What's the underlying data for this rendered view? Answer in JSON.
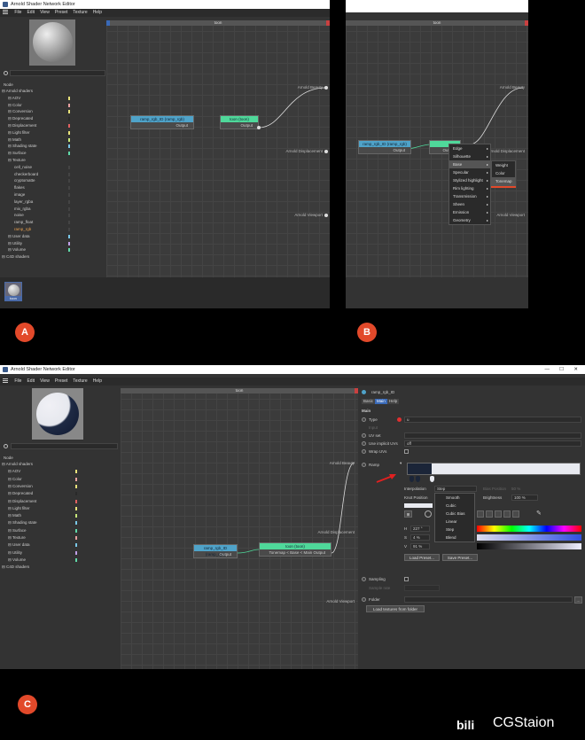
{
  "panel_a": {
    "title": "Arnold Shader Network Editor",
    "menu": [
      "File",
      "Edit",
      "View",
      "Preset",
      "Texture",
      "Help"
    ],
    "tree_header": "Node",
    "tree": [
      {
        "label": "Arnold shaders",
        "color": ""
      },
      {
        "label": "AOV",
        "color": "#e8e27a"
      },
      {
        "label": "Color",
        "color": "#e8a0a0"
      },
      {
        "label": "Conversion",
        "color": "#e8e27a"
      },
      {
        "label": "Deprecated",
        "color": "#2a2a2a"
      },
      {
        "label": "Displacement",
        "color": "#e06060"
      },
      {
        "label": "Light filter",
        "color": "#e8e27a"
      },
      {
        "label": "Math",
        "color": "#c8e87a"
      },
      {
        "label": "Shading state",
        "color": "#7ac8e8"
      },
      {
        "label": "Surface",
        "color": "#60d8a8"
      },
      {
        "label": "Texture",
        "color": ""
      },
      {
        "label": "cell_noise",
        "color": "#444"
      },
      {
        "label": "checkerboard",
        "color": "#444"
      },
      {
        "label": "cryptomatte",
        "color": "#444"
      },
      {
        "label": "flakes",
        "color": "#444"
      },
      {
        "label": "image",
        "color": "#444"
      },
      {
        "label": "layer_rgba",
        "color": "#444"
      },
      {
        "label": "mix_rgba",
        "color": "#444"
      },
      {
        "label": "noise",
        "color": "#444"
      },
      {
        "label": "ramp_float",
        "color": "#444"
      },
      {
        "label": "ramp_rgb",
        "color": "#444"
      },
      {
        "label": "User data",
        "color": "#7ac8e8"
      },
      {
        "label": "Utility",
        "color": "#c0a0e8"
      },
      {
        "label": "Volume",
        "color": "#60d8a8"
      },
      {
        "label": "C4D shaders",
        "color": ""
      }
    ],
    "canvas_tab": "toon",
    "node_ramp": {
      "title": "ramp_rgb_ID (ramp_rgb)",
      "output": "Output"
    },
    "node_toon": {
      "title": "toon (toon)",
      "output": "Output"
    },
    "outputs": [
      "Arnold Beauty",
      "Arnold Displacement",
      "Arnold Viewport"
    ],
    "thumb_label": "toon",
    "badge": "A"
  },
  "panel_b": {
    "canvas_tab": "toon",
    "node_ramp": {
      "title": "ramp_rgb_ID (ramp_rgb)",
      "output": "Output"
    },
    "node_toon_out": "Output",
    "outputs": [
      "Arnold Beauty",
      "Arnold Displacement",
      "Arnold Viewport"
    ],
    "menu1": [
      "Edge",
      "Silhouette",
      "Base",
      "Specular",
      "Stylized highlight",
      "Rim lighting",
      "Transmission",
      "Sheen",
      "Emission",
      "Geometry"
    ],
    "menu2": [
      "Weight",
      "Color",
      "Tonemap"
    ],
    "badge": "B"
  },
  "panel_c": {
    "title": "Arnold Shader Network Editor",
    "menu": [
      "File",
      "Edit",
      "View",
      "Preset",
      "Texture",
      "Help"
    ],
    "tree_header": "Node",
    "tree": [
      {
        "label": "Arnold shaders",
        "color": ""
      },
      {
        "label": "AOV",
        "color": "#e8e27a"
      },
      {
        "label": "Color",
        "color": "#e8a0a0"
      },
      {
        "label": "Conversion",
        "color": "#e8e27a"
      },
      {
        "label": "Deprecated",
        "color": "#2a2a2a"
      },
      {
        "label": "Displacement",
        "color": "#e06060"
      },
      {
        "label": "Light filter",
        "color": "#e8e27a"
      },
      {
        "label": "Math",
        "color": "#c8e87a"
      },
      {
        "label": "Shading state",
        "color": "#7ac8e8"
      },
      {
        "label": "Surface",
        "color": "#60d8a8"
      },
      {
        "label": "Texture",
        "color": "#e8a0a0"
      },
      {
        "label": "User data",
        "color": "#7ac8e8"
      },
      {
        "label": "Utility",
        "color": "#c0a0e8"
      },
      {
        "label": "Volume",
        "color": "#60d8a8"
      },
      {
        "label": "C4D shaders",
        "color": ""
      }
    ],
    "canvas_tab": "toon",
    "node_ramp": {
      "title": "ramp_rgb_ID (ramp_rgb)",
      "output": "Output"
    },
    "node_toon": {
      "title": "toon (toon)",
      "output": "Tonemap < Base < Main Output"
    },
    "outputs": [
      "Arnold Beauty",
      "Arnold Displacement",
      "Arnold Viewport"
    ],
    "window_controls": [
      "—",
      "☐",
      "✕"
    ],
    "props": {
      "node_name": "ramp_rgb_ID",
      "tabs": [
        "Basic",
        "Main",
        "Help"
      ],
      "section": "Main",
      "type_label": "Type",
      "type_value": "u",
      "input_label": "Input",
      "uvset_label": "UV set",
      "use_implicit_label": "Use implicit UVs",
      "use_implicit_value": "off",
      "wrap_label": "Wrap UVs",
      "ramp_label": "Ramp",
      "interpolation_label": "Interpolation",
      "interpolation_value": "Step",
      "knot_label": "Knot Position",
      "bias_label": "Bias Position",
      "bias_value": "50 %",
      "brightness_label": "Brightness",
      "brightness_value": "100 %",
      "h_label": "H",
      "h_value": "227 °",
      "s_label": "S",
      "s_value": "4 %",
      "v_label": "V",
      "v_value": "91 %",
      "interp_options": [
        "Smooth",
        "Cubic",
        "Cubic Bias",
        "Linear",
        "Step",
        "Blend"
      ],
      "load_preset": "Load Preset...",
      "save_preset": "Save Preset...",
      "sampling_label": "Sampling",
      "sample_rate_label": "Sample rate",
      "folder_label": "Folder",
      "load_textures": "Load textures from folder"
    },
    "badge": "C"
  },
  "watermark": "CGStaion"
}
